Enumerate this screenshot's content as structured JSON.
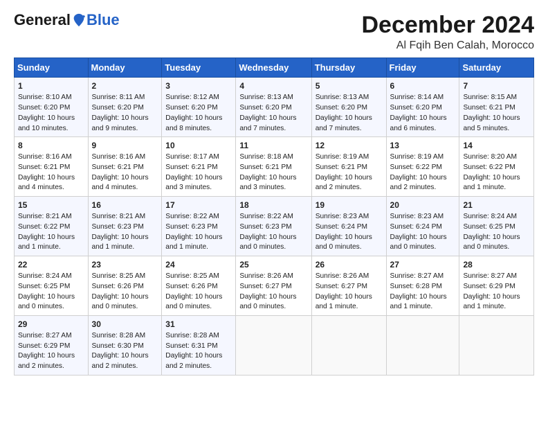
{
  "logo": {
    "general": "General",
    "blue": "Blue"
  },
  "title": "December 2024",
  "subtitle": "Al Fqih Ben Calah, Morocco",
  "header": {
    "days": [
      "Sunday",
      "Monday",
      "Tuesday",
      "Wednesday",
      "Thursday",
      "Friday",
      "Saturday"
    ]
  },
  "weeks": [
    [
      {
        "day": "1",
        "info": "Sunrise: 8:10 AM\nSunset: 6:20 PM\nDaylight: 10 hours\nand 10 minutes."
      },
      {
        "day": "2",
        "info": "Sunrise: 8:11 AM\nSunset: 6:20 PM\nDaylight: 10 hours\nand 9 minutes."
      },
      {
        "day": "3",
        "info": "Sunrise: 8:12 AM\nSunset: 6:20 PM\nDaylight: 10 hours\nand 8 minutes."
      },
      {
        "day": "4",
        "info": "Sunrise: 8:13 AM\nSunset: 6:20 PM\nDaylight: 10 hours\nand 7 minutes."
      },
      {
        "day": "5",
        "info": "Sunrise: 8:13 AM\nSunset: 6:20 PM\nDaylight: 10 hours\nand 7 minutes."
      },
      {
        "day": "6",
        "info": "Sunrise: 8:14 AM\nSunset: 6:20 PM\nDaylight: 10 hours\nand 6 minutes."
      },
      {
        "day": "7",
        "info": "Sunrise: 8:15 AM\nSunset: 6:21 PM\nDaylight: 10 hours\nand 5 minutes."
      }
    ],
    [
      {
        "day": "8",
        "info": "Sunrise: 8:16 AM\nSunset: 6:21 PM\nDaylight: 10 hours\nand 4 minutes."
      },
      {
        "day": "9",
        "info": "Sunrise: 8:16 AM\nSunset: 6:21 PM\nDaylight: 10 hours\nand 4 minutes."
      },
      {
        "day": "10",
        "info": "Sunrise: 8:17 AM\nSunset: 6:21 PM\nDaylight: 10 hours\nand 3 minutes."
      },
      {
        "day": "11",
        "info": "Sunrise: 8:18 AM\nSunset: 6:21 PM\nDaylight: 10 hours\nand 3 minutes."
      },
      {
        "day": "12",
        "info": "Sunrise: 8:19 AM\nSunset: 6:21 PM\nDaylight: 10 hours\nand 2 minutes."
      },
      {
        "day": "13",
        "info": "Sunrise: 8:19 AM\nSunset: 6:22 PM\nDaylight: 10 hours\nand 2 minutes."
      },
      {
        "day": "14",
        "info": "Sunrise: 8:20 AM\nSunset: 6:22 PM\nDaylight: 10 hours\nand 1 minute."
      }
    ],
    [
      {
        "day": "15",
        "info": "Sunrise: 8:21 AM\nSunset: 6:22 PM\nDaylight: 10 hours\nand 1 minute."
      },
      {
        "day": "16",
        "info": "Sunrise: 8:21 AM\nSunset: 6:23 PM\nDaylight: 10 hours\nand 1 minute."
      },
      {
        "day": "17",
        "info": "Sunrise: 8:22 AM\nSunset: 6:23 PM\nDaylight: 10 hours\nand 1 minute."
      },
      {
        "day": "18",
        "info": "Sunrise: 8:22 AM\nSunset: 6:23 PM\nDaylight: 10 hours\nand 0 minutes."
      },
      {
        "day": "19",
        "info": "Sunrise: 8:23 AM\nSunset: 6:24 PM\nDaylight: 10 hours\nand 0 minutes."
      },
      {
        "day": "20",
        "info": "Sunrise: 8:23 AM\nSunset: 6:24 PM\nDaylight: 10 hours\nand 0 minutes."
      },
      {
        "day": "21",
        "info": "Sunrise: 8:24 AM\nSunset: 6:25 PM\nDaylight: 10 hours\nand 0 minutes."
      }
    ],
    [
      {
        "day": "22",
        "info": "Sunrise: 8:24 AM\nSunset: 6:25 PM\nDaylight: 10 hours\nand 0 minutes."
      },
      {
        "day": "23",
        "info": "Sunrise: 8:25 AM\nSunset: 6:26 PM\nDaylight: 10 hours\nand 0 minutes."
      },
      {
        "day": "24",
        "info": "Sunrise: 8:25 AM\nSunset: 6:26 PM\nDaylight: 10 hours\nand 0 minutes."
      },
      {
        "day": "25",
        "info": "Sunrise: 8:26 AM\nSunset: 6:27 PM\nDaylight: 10 hours\nand 0 minutes."
      },
      {
        "day": "26",
        "info": "Sunrise: 8:26 AM\nSunset: 6:27 PM\nDaylight: 10 hours\nand 1 minute."
      },
      {
        "day": "27",
        "info": "Sunrise: 8:27 AM\nSunset: 6:28 PM\nDaylight: 10 hours\nand 1 minute."
      },
      {
        "day": "28",
        "info": "Sunrise: 8:27 AM\nSunset: 6:29 PM\nDaylight: 10 hours\nand 1 minute."
      }
    ],
    [
      {
        "day": "29",
        "info": "Sunrise: 8:27 AM\nSunset: 6:29 PM\nDaylight: 10 hours\nand 2 minutes."
      },
      {
        "day": "30",
        "info": "Sunrise: 8:28 AM\nSunset: 6:30 PM\nDaylight: 10 hours\nand 2 minutes."
      },
      {
        "day": "31",
        "info": "Sunrise: 8:28 AM\nSunset: 6:31 PM\nDaylight: 10 hours\nand 2 minutes."
      },
      null,
      null,
      null,
      null
    ]
  ]
}
